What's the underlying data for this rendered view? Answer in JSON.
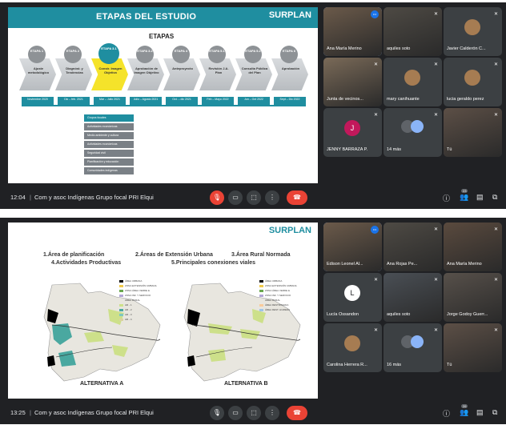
{
  "call1": {
    "time": "12:04",
    "meeting_title": "Com y asoc Indígenas Grupo focal PRI Elqui",
    "slide": {
      "title": "ETAPAS DEL ESTUDIO",
      "logo": "SURPLAN",
      "etapas_label": "ETAPAS",
      "stages": [
        {
          "num": "ETAPA 1",
          "name": "Ajuste metodológico",
          "date": "Noviembre 2020",
          "active": false
        },
        {
          "num": "ETAPA 2",
          "name": "Diagnóst. y Tendencias",
          "date": "Dic – feb. 2021",
          "active": false
        },
        {
          "num": "ETAPA 3.1",
          "name": "Constr. Imagen Objetivo",
          "date": "Mar – Julio 2021",
          "active": true
        },
        {
          "num": "ETAPA 3.2",
          "name": "Aprobación de Imagen Objetivo",
          "date": "Julio – Agosto 2021",
          "active": false
        },
        {
          "num": "ETAPA 4",
          "name": "Anteproyecto",
          "date": "Oct. – dic 2021",
          "active": false
        },
        {
          "num": "ETAPA 5.1",
          "name": "Revisión J.A. Plan",
          "date": "Feb – Mayo 2022",
          "active": false
        },
        {
          "num": "ETAPA 5.2",
          "name": "Consulta Pública del Plan",
          "date": "Jun – Oct 2022",
          "active": false
        },
        {
          "num": "ETAPA 6",
          "name": "Aprobación",
          "date": "Sept – Dic 2022",
          "active": false
        }
      ],
      "groups": [
        "Grupos focales",
        "Actividades económicas",
        "Medio ambiente y cultura",
        "Actividades económicas",
        "Seguridad civil",
        "Planificación y educación",
        "Comunidades indígenas"
      ]
    },
    "participants": [
      {
        "name": "Ana María Merino",
        "type": "photo",
        "speaking": true
      },
      {
        "name": "aquiles soto",
        "type": "photo"
      },
      {
        "name": "Javier Calderón C...",
        "type": "avatar-photo"
      },
      {
        "name": "Junta de vecinos...",
        "type": "photo"
      },
      {
        "name": "mary canihuante",
        "type": "avatar-photo"
      },
      {
        "name": "lucia geraldo perez",
        "type": "avatar-photo"
      },
      {
        "name": "JENNY BARRAZA P.",
        "type": "letter",
        "letter": "J",
        "color": "#c2185b"
      },
      {
        "name": "14 más",
        "type": "more"
      },
      {
        "name": "Tú",
        "type": "photo"
      }
    ],
    "controls": {
      "participants_count": "23"
    }
  },
  "call2": {
    "time": "13:25",
    "meeting_title": "Com y asoc Indígenas Grupo focal PRI Elqui",
    "slide": {
      "logo": "SURPLAN",
      "objectives": [
        "1.Área de planificación",
        "2.Áreas de Extensión Urbana",
        "3.Área Rural Normada",
        "4.Actividades Productivas",
        "5.Principales conexiones viales"
      ],
      "alt_a": "ALTERNATIVA A",
      "alt_b": "ALTERNATIVA B",
      "legend_a": [
        "ÁREA URBANA",
        "ZONA EXTENSIÓN URBANA",
        "ZONA ÁREA VERDE E",
        "ZONA INF. Y SERVICIO",
        "ÁREA RURAL",
        "AR - 1",
        "AR - 2",
        "AR - 3",
        "AR - 4"
      ],
      "legend_b": [
        "ÁREA URBANA",
        "ZONA EXTENSIÓN URBANA",
        "ZONA ÁREA VERDE E",
        "ZONA INF. Y SERVICIO",
        "ÁREA RURAL",
        "ÁREA RESTRINGIDA",
        "ÁREA REST. HUMEDA"
      ]
    },
    "participants": [
      {
        "name": "Edison Leonel Al...",
        "type": "photo",
        "speaking": true
      },
      {
        "name": "Ana Rojas Pe...",
        "type": "photo"
      },
      {
        "name": "Ana María Merino",
        "type": "photo"
      },
      {
        "name": "Lucía Ossandon",
        "type": "letter",
        "letter": "L",
        "color": "#ffffff"
      },
      {
        "name": "aquiles soto",
        "type": "photo"
      },
      {
        "name": "Jorge Godoy Guerr...",
        "type": "photo"
      },
      {
        "name": "Carolina Herrera R...",
        "type": "avatar-photo"
      },
      {
        "name": "16 más",
        "type": "more"
      },
      {
        "name": "Tú",
        "type": "photo"
      }
    ],
    "controls": {
      "participants_count": "26"
    }
  },
  "icons": {
    "mic": "mic-icon",
    "camera": "camera-icon",
    "present": "present-icon",
    "more": "more-icon",
    "hangup": "hangup-icon",
    "info": "info-icon",
    "people": "people-icon",
    "chat": "chat-icon",
    "activities": "activities-icon"
  }
}
